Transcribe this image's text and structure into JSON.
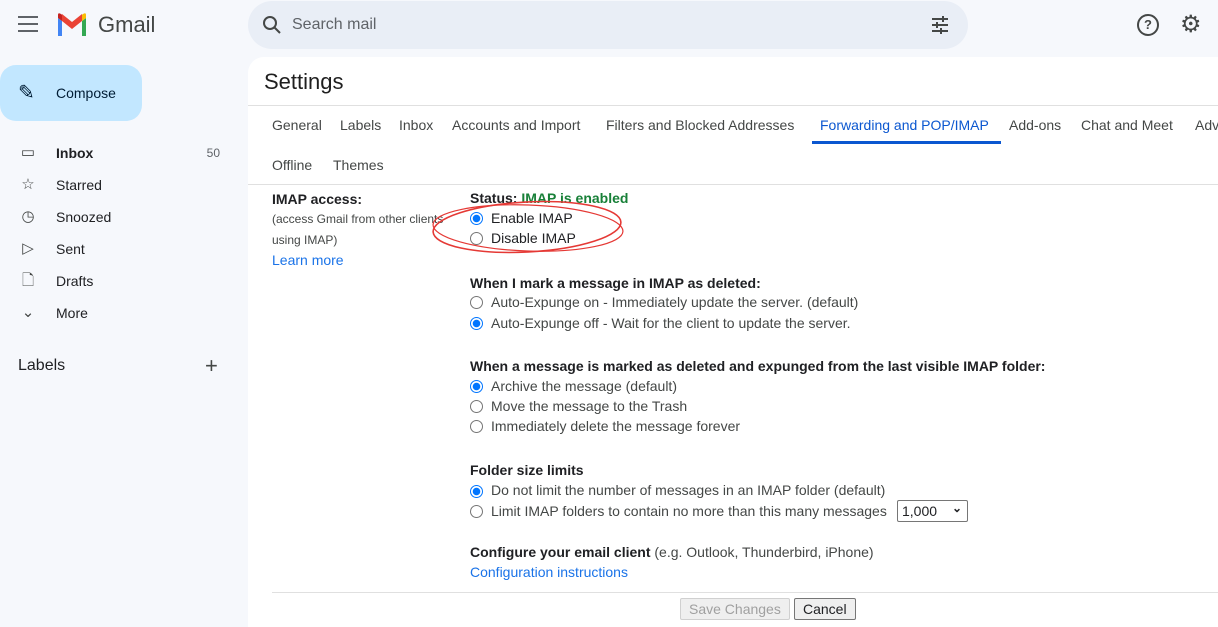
{
  "header": {
    "brand": "Gmail",
    "search_placeholder": "Search mail",
    "icons": [
      "menu-icon",
      "search-icon",
      "tune-icon",
      "help-icon",
      "gear-icon"
    ]
  },
  "sidebar": {
    "compose": "Compose",
    "items": [
      {
        "label": "Inbox",
        "count": "50",
        "icon": "inbox-icon"
      },
      {
        "label": "Starred",
        "icon": "star-icon"
      },
      {
        "label": "Snoozed",
        "icon": "clock-icon"
      },
      {
        "label": "Sent",
        "icon": "send-icon"
      },
      {
        "label": "Drafts",
        "icon": "file-icon"
      },
      {
        "label": "More",
        "icon": "chevron-down-icon"
      }
    ],
    "labels_heading": "Labels"
  },
  "settings": {
    "title": "Settings",
    "tabs": [
      "General",
      "Labels",
      "Inbox",
      "Accounts and Import",
      "Filters and Blocked Addresses",
      "Forwarding and POP/IMAP",
      "Add-ons",
      "Chat and Meet",
      "Adv",
      "Offline",
      "Themes"
    ],
    "active_tab": "Forwarding and POP/IMAP",
    "imap": {
      "label": "IMAP access:",
      "desc1": "(access Gmail from other clients",
      "desc2": "using IMAP)",
      "learn_more": "Learn more",
      "status_prefix": "Status: ",
      "status": "IMAP is enabled",
      "enable": "Enable IMAP",
      "disable": "Disable IMAP",
      "enabled": true
    },
    "deleted": {
      "heading": "When I mark a message in IMAP as deleted:",
      "options": [
        "Auto-Expunge on - Immediately update the server. (default)",
        "Auto-Expunge off - Wait for the client to update the server."
      ],
      "selected": 1
    },
    "expunged": {
      "heading": "When a message is marked as deleted and expunged from the last visible IMAP folder:",
      "options": [
        "Archive the message (default)",
        "Move the message to the Trash",
        "Immediately delete the message forever"
      ],
      "selected": 0
    },
    "folder": {
      "heading": "Folder size limits",
      "options": [
        "Do not limit the number of messages in an IMAP folder (default)",
        "Limit IMAP folders to contain no more than this many messages"
      ],
      "selected": 0,
      "limit_value": "1,000"
    },
    "client": {
      "heading": "Configure your email client",
      "hint": " (e.g. Outlook, Thunderbird, iPhone)",
      "link": "Configuration instructions"
    },
    "save": "Save Changes",
    "cancel": "Cancel"
  },
  "colors": {
    "accent": "#0b57d0",
    "status_green": "#188038",
    "annotation": "#e53935"
  }
}
